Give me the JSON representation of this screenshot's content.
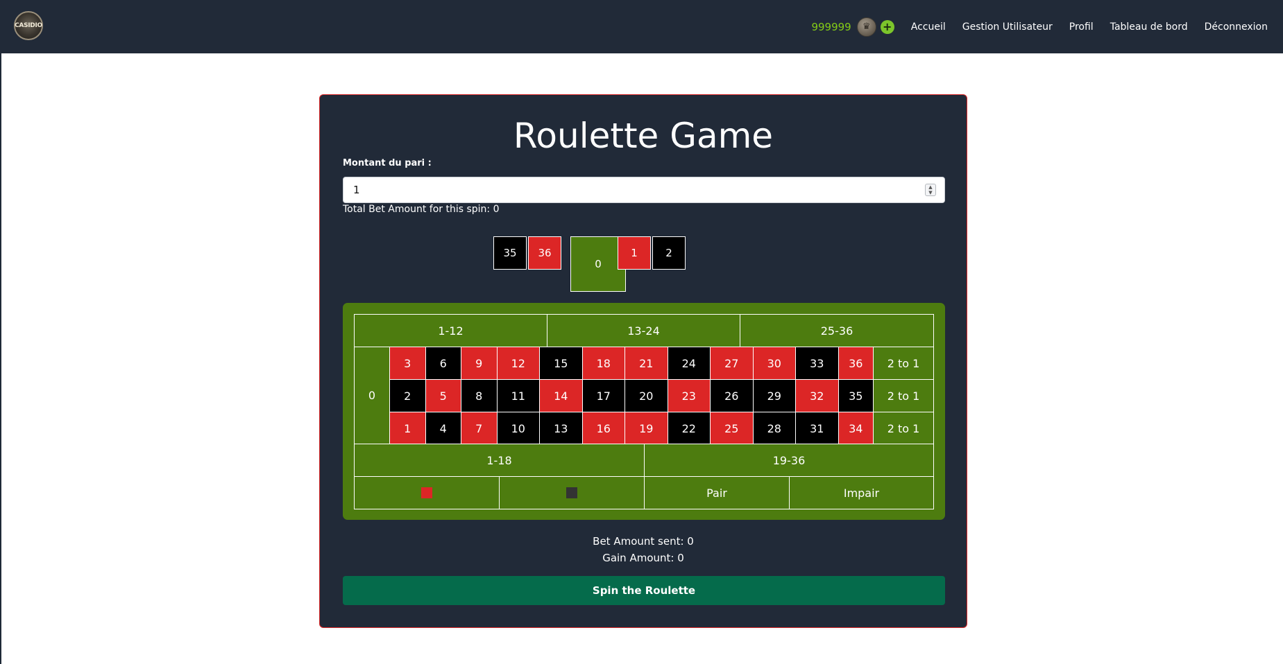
{
  "navbar": {
    "logo_text": "CASIDIO",
    "balance": "999999",
    "add_funds_symbol": "+",
    "links": [
      "Accueil",
      "Gestion Utilisateur",
      "Profil",
      "Tableau de bord",
      "Déconnexion"
    ]
  },
  "game": {
    "title": "Roulette Game",
    "bet_label": "Montant du pari :",
    "bet_value": "1",
    "total_bet_text": "Total Bet Amount for this spin: 0",
    "wheel": [
      {
        "num": "35",
        "color": "black"
      },
      {
        "num": "36",
        "color": "red"
      },
      {
        "num": "0",
        "color": "green"
      },
      {
        "num": "1",
        "color": "red"
      },
      {
        "num": "2",
        "color": "black"
      }
    ],
    "dozens": [
      "1-12",
      "13-24",
      "25-36"
    ],
    "zero_label": "0",
    "rows": [
      [
        {
          "n": "3",
          "c": "red"
        },
        {
          "n": "6",
          "c": "black"
        },
        {
          "n": "9",
          "c": "red"
        },
        {
          "n": "12",
          "c": "red"
        },
        {
          "n": "15",
          "c": "black"
        },
        {
          "n": "18",
          "c": "red"
        },
        {
          "n": "21",
          "c": "red"
        },
        {
          "n": "24",
          "c": "black"
        },
        {
          "n": "27",
          "c": "red"
        },
        {
          "n": "30",
          "c": "red"
        },
        {
          "n": "33",
          "c": "black"
        },
        {
          "n": "36",
          "c": "red"
        }
      ],
      [
        {
          "n": "2",
          "c": "black"
        },
        {
          "n": "5",
          "c": "red"
        },
        {
          "n": "8",
          "c": "black"
        },
        {
          "n": "11",
          "c": "black"
        },
        {
          "n": "14",
          "c": "red"
        },
        {
          "n": "17",
          "c": "black"
        },
        {
          "n": "20",
          "c": "black"
        },
        {
          "n": "23",
          "c": "red"
        },
        {
          "n": "26",
          "c": "black"
        },
        {
          "n": "29",
          "c": "black"
        },
        {
          "n": "32",
          "c": "red"
        },
        {
          "n": "35",
          "c": "black"
        }
      ],
      [
        {
          "n": "1",
          "c": "red"
        },
        {
          "n": "4",
          "c": "black"
        },
        {
          "n": "7",
          "c": "red"
        },
        {
          "n": "10",
          "c": "black"
        },
        {
          "n": "13",
          "c": "black"
        },
        {
          "n": "16",
          "c": "red"
        },
        {
          "n": "19",
          "c": "red"
        },
        {
          "n": "22",
          "c": "black"
        },
        {
          "n": "25",
          "c": "red"
        },
        {
          "n": "28",
          "c": "black"
        },
        {
          "n": "31",
          "c": "black"
        },
        {
          "n": "34",
          "c": "red"
        }
      ]
    ],
    "column_bet_label": "2 to 1",
    "halves": [
      "1-18",
      "19-36"
    ],
    "even_money": [
      "",
      "",
      "Pair",
      "Impair"
    ],
    "bet_sent_text": "Bet Amount sent: 0",
    "gain_text": "Gain Amount: 0",
    "spin_label": "Spin the Roulette"
  },
  "colors": {
    "red": "#dc2626",
    "black": "#000000",
    "green": "#4d7c0f",
    "navbar": "#212a38",
    "accent_balance": "#84cc16",
    "spin_button": "#056b4b",
    "swatch_red": "#dc2626",
    "swatch_black": "#333333"
  }
}
